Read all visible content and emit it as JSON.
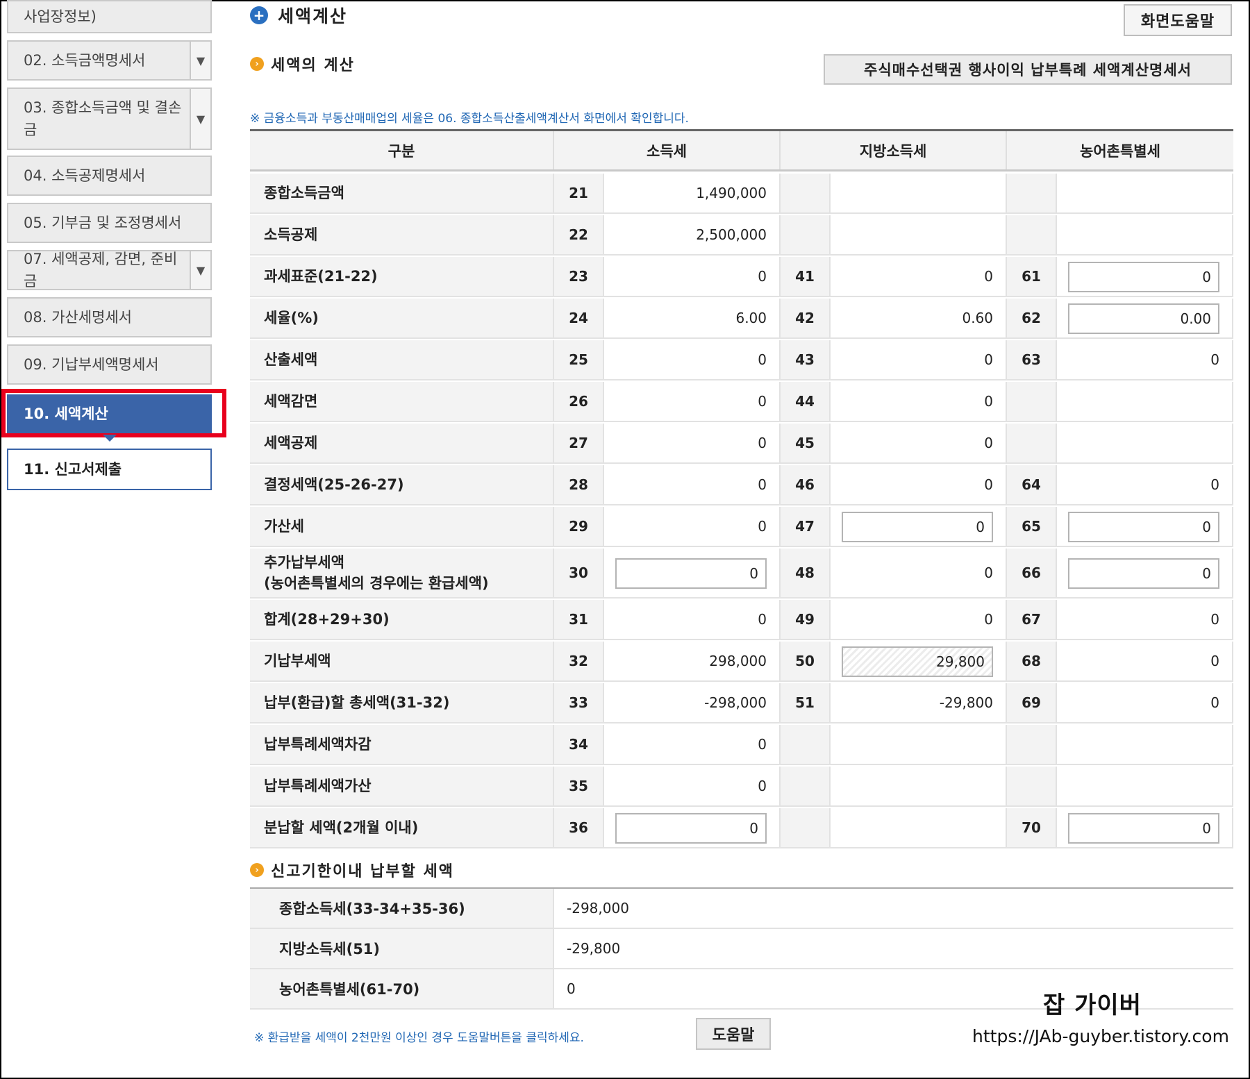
{
  "sidebar": {
    "items": [
      {
        "label": "사업장정보)",
        "dropdown": false
      },
      {
        "label": "02. 소득금액명세서",
        "dropdown": true
      },
      {
        "label": "03. 종합소득금액 및 결손\n금",
        "dropdown": true
      },
      {
        "label": "04. 소득공제명세서",
        "dropdown": false
      },
      {
        "label": "05. 기부금 및 조정명세서",
        "dropdown": false
      },
      {
        "label": "07. 세액공제, 감면, 준비금",
        "dropdown": true
      },
      {
        "label": "08. 가산세명세서",
        "dropdown": false
      },
      {
        "label": "09. 기납부세액명세서",
        "dropdown": false
      },
      {
        "label": "10. 세액계산",
        "dropdown": false,
        "active": true
      },
      {
        "label": "11. 신고서제출",
        "dropdown": false
      }
    ]
  },
  "page": {
    "title": "세액계산",
    "help_button": "화면도움말"
  },
  "calc": {
    "heading": "세액의 계산",
    "stock_button": "주식매수선택권 행사이익 납부특례 세액계산명세서",
    "note": "※ 금융소득과 부동산매매업의 세율은 06. 종합소득산출세액계산서 화면에서 확인합니다.",
    "headers": {
      "category": "구분",
      "income_tax": "소득세",
      "local_tax": "지방소득세",
      "rural_tax": "농어촌특별세"
    },
    "rows": [
      {
        "label": "종합소득금액",
        "c1": "21",
        "v1": "1,490,000"
      },
      {
        "label": "소득공제",
        "c1": "22",
        "v1": "2,500,000"
      },
      {
        "label": "과세표준(21-22)",
        "c1": "23",
        "v1": "0",
        "c2": "41",
        "v2": "0",
        "c3": "61",
        "v3": "0"
      },
      {
        "label": "세율(%)",
        "c1": "24",
        "v1": "6.00",
        "c2": "42",
        "v2": "0.60",
        "c3": "62",
        "v3": "0.00"
      },
      {
        "label": "산출세액",
        "c1": "25",
        "v1": "0",
        "c2": "43",
        "v2": "0",
        "c3": "63",
        "v3": "0"
      },
      {
        "label": "세액감면",
        "c1": "26",
        "v1": "0",
        "c2": "44",
        "v2": "0"
      },
      {
        "label": "세액공제",
        "c1": "27",
        "v1": "0",
        "c2": "45",
        "v2": "0"
      },
      {
        "label": "결정세액(25-26-27)",
        "c1": "28",
        "v1": "0",
        "c2": "46",
        "v2": "0",
        "c3": "64",
        "v3": "0"
      },
      {
        "label": "가산세",
        "c1": "29",
        "v1": "0",
        "c2": "47",
        "v2": "0",
        "c3": "65",
        "v3": "0"
      },
      {
        "label": "추가납부세액\n(농어촌특별세의 경우에는 환급세액)",
        "c1": "30",
        "v1": "0",
        "c2": "48",
        "v2": "0",
        "c3": "66",
        "v3": "0"
      },
      {
        "label": "합계(28+29+30)",
        "c1": "31",
        "v1": "0",
        "c2": "49",
        "v2": "0",
        "c3": "67",
        "v3": "0"
      },
      {
        "label": "기납부세액",
        "c1": "32",
        "v1": "298,000",
        "c2": "50",
        "v2": "29,800",
        "c3": "68",
        "v3": "0"
      },
      {
        "label": "납부(환급)할 총세액(31-32)",
        "c1": "33",
        "v1": "-298,000",
        "c2": "51",
        "v2": "-29,800",
        "c3": "69",
        "v3": "0"
      },
      {
        "label": "납부특례세액차감",
        "c1": "34",
        "v1": "0"
      },
      {
        "label": "납부특례세액가산",
        "c1": "35",
        "v1": "0"
      },
      {
        "label": "분납할 세액(2개월 이내)",
        "c1": "36",
        "v1": "0",
        "c3": "70",
        "v3": "0"
      }
    ]
  },
  "due": {
    "heading": "신고기한이내 납부할 세액",
    "rows": [
      {
        "label": "종합소득세(33-34+35-36)",
        "value": "-298,000"
      },
      {
        "label": "지방소득세(51)",
        "value": "-29,800"
      },
      {
        "label": "농어촌특별세(61-70)",
        "value": "0"
      }
    ],
    "note": "※ 환급받을 세액이 2천만원 이상인 경우 도움말버튼을 클릭하세요.",
    "help_button": "도움말"
  },
  "watermark": {
    "name": "잡 가이버",
    "url": "https://JAb-guyber.tistory.com"
  },
  "icons": {
    "title": "plus-circle-icon",
    "section": "orange-bullet-icon",
    "dropdown": "chevron-down-icon"
  },
  "colors": {
    "active": "#3a64a8",
    "highlight": "#e8001d",
    "note": "#2067b4",
    "bullet": "#f0a01e"
  }
}
